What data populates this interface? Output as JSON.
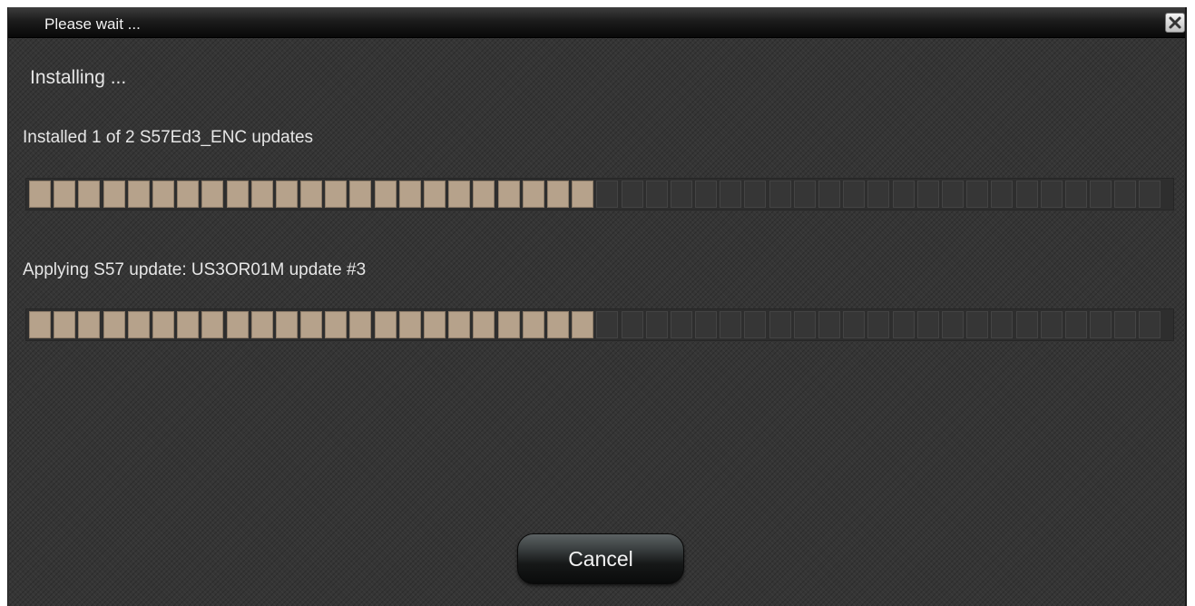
{
  "window": {
    "title": "Please wait ..."
  },
  "main": {
    "heading": "Installing ...",
    "status_line_1": "Installed 1 of 2 S57Ed3_ENC updates",
    "status_line_2": "Applying S57 update: US3OR01M update #3"
  },
  "progress": {
    "bar1_fraction": 0.5,
    "bar2_fraction": 0.5
  },
  "buttons": {
    "cancel_label": "Cancel",
    "close_icon": "close-icon"
  },
  "colors": {
    "segment_filled": "#b6a28b",
    "background": "#353535"
  }
}
